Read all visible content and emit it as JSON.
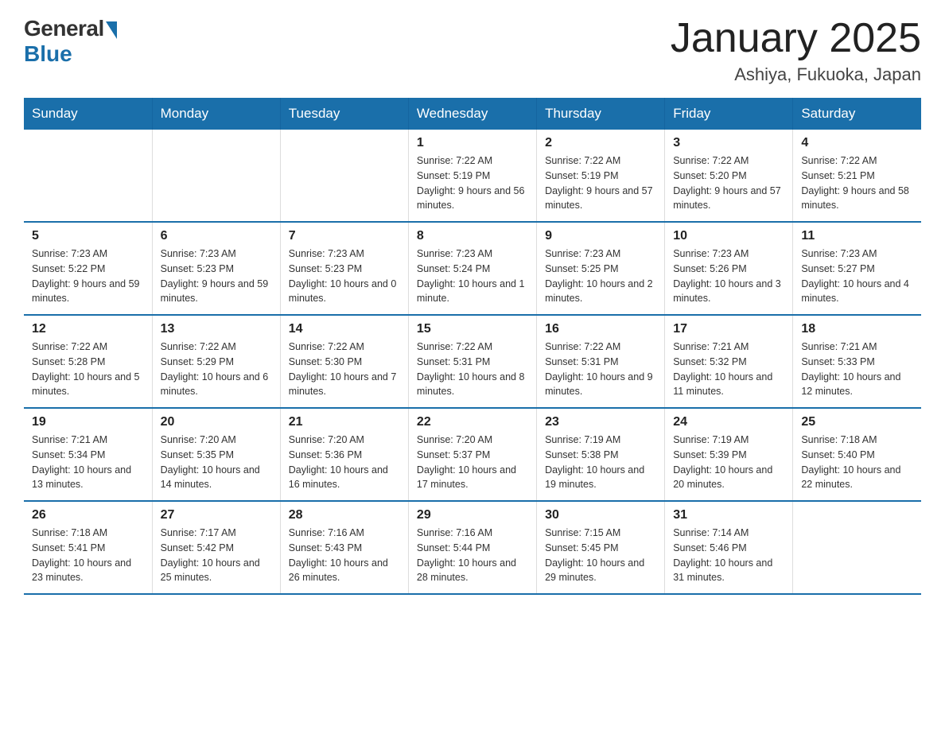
{
  "logo": {
    "general": "General",
    "blue": "Blue"
  },
  "title": {
    "month": "January 2025",
    "location": "Ashiya, Fukuoka, Japan"
  },
  "weekdays": [
    "Sunday",
    "Monday",
    "Tuesday",
    "Wednesday",
    "Thursday",
    "Friday",
    "Saturday"
  ],
  "weeks": [
    [
      null,
      null,
      null,
      {
        "day": 1,
        "sunrise": "7:22 AM",
        "sunset": "5:19 PM",
        "daylight": "9 hours and 56 minutes."
      },
      {
        "day": 2,
        "sunrise": "7:22 AM",
        "sunset": "5:19 PM",
        "daylight": "9 hours and 57 minutes."
      },
      {
        "day": 3,
        "sunrise": "7:22 AM",
        "sunset": "5:20 PM",
        "daylight": "9 hours and 57 minutes."
      },
      {
        "day": 4,
        "sunrise": "7:22 AM",
        "sunset": "5:21 PM",
        "daylight": "9 hours and 58 minutes."
      }
    ],
    [
      {
        "day": 5,
        "sunrise": "7:23 AM",
        "sunset": "5:22 PM",
        "daylight": "9 hours and 59 minutes."
      },
      {
        "day": 6,
        "sunrise": "7:23 AM",
        "sunset": "5:23 PM",
        "daylight": "9 hours and 59 minutes."
      },
      {
        "day": 7,
        "sunrise": "7:23 AM",
        "sunset": "5:23 PM",
        "daylight": "10 hours and 0 minutes."
      },
      {
        "day": 8,
        "sunrise": "7:23 AM",
        "sunset": "5:24 PM",
        "daylight": "10 hours and 1 minute."
      },
      {
        "day": 9,
        "sunrise": "7:23 AM",
        "sunset": "5:25 PM",
        "daylight": "10 hours and 2 minutes."
      },
      {
        "day": 10,
        "sunrise": "7:23 AM",
        "sunset": "5:26 PM",
        "daylight": "10 hours and 3 minutes."
      },
      {
        "day": 11,
        "sunrise": "7:23 AM",
        "sunset": "5:27 PM",
        "daylight": "10 hours and 4 minutes."
      }
    ],
    [
      {
        "day": 12,
        "sunrise": "7:22 AM",
        "sunset": "5:28 PM",
        "daylight": "10 hours and 5 minutes."
      },
      {
        "day": 13,
        "sunrise": "7:22 AM",
        "sunset": "5:29 PM",
        "daylight": "10 hours and 6 minutes."
      },
      {
        "day": 14,
        "sunrise": "7:22 AM",
        "sunset": "5:30 PM",
        "daylight": "10 hours and 7 minutes."
      },
      {
        "day": 15,
        "sunrise": "7:22 AM",
        "sunset": "5:31 PM",
        "daylight": "10 hours and 8 minutes."
      },
      {
        "day": 16,
        "sunrise": "7:22 AM",
        "sunset": "5:31 PM",
        "daylight": "10 hours and 9 minutes."
      },
      {
        "day": 17,
        "sunrise": "7:21 AM",
        "sunset": "5:32 PM",
        "daylight": "10 hours and 11 minutes."
      },
      {
        "day": 18,
        "sunrise": "7:21 AM",
        "sunset": "5:33 PM",
        "daylight": "10 hours and 12 minutes."
      }
    ],
    [
      {
        "day": 19,
        "sunrise": "7:21 AM",
        "sunset": "5:34 PM",
        "daylight": "10 hours and 13 minutes."
      },
      {
        "day": 20,
        "sunrise": "7:20 AM",
        "sunset": "5:35 PM",
        "daylight": "10 hours and 14 minutes."
      },
      {
        "day": 21,
        "sunrise": "7:20 AM",
        "sunset": "5:36 PM",
        "daylight": "10 hours and 16 minutes."
      },
      {
        "day": 22,
        "sunrise": "7:20 AM",
        "sunset": "5:37 PM",
        "daylight": "10 hours and 17 minutes."
      },
      {
        "day": 23,
        "sunrise": "7:19 AM",
        "sunset": "5:38 PM",
        "daylight": "10 hours and 19 minutes."
      },
      {
        "day": 24,
        "sunrise": "7:19 AM",
        "sunset": "5:39 PM",
        "daylight": "10 hours and 20 minutes."
      },
      {
        "day": 25,
        "sunrise": "7:18 AM",
        "sunset": "5:40 PM",
        "daylight": "10 hours and 22 minutes."
      }
    ],
    [
      {
        "day": 26,
        "sunrise": "7:18 AM",
        "sunset": "5:41 PM",
        "daylight": "10 hours and 23 minutes."
      },
      {
        "day": 27,
        "sunrise": "7:17 AM",
        "sunset": "5:42 PM",
        "daylight": "10 hours and 25 minutes."
      },
      {
        "day": 28,
        "sunrise": "7:16 AM",
        "sunset": "5:43 PM",
        "daylight": "10 hours and 26 minutes."
      },
      {
        "day": 29,
        "sunrise": "7:16 AM",
        "sunset": "5:44 PM",
        "daylight": "10 hours and 28 minutes."
      },
      {
        "day": 30,
        "sunrise": "7:15 AM",
        "sunset": "5:45 PM",
        "daylight": "10 hours and 29 minutes."
      },
      {
        "day": 31,
        "sunrise": "7:14 AM",
        "sunset": "5:46 PM",
        "daylight": "10 hours and 31 minutes."
      },
      null
    ]
  ]
}
